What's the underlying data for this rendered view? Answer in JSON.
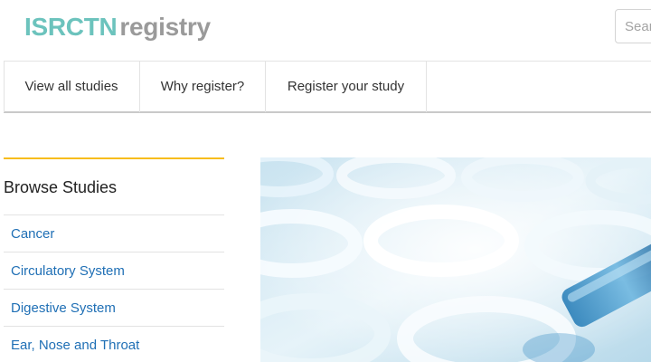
{
  "header": {
    "logo_primary": "ISRCTN",
    "logo_secondary": "registry",
    "search_placeholder": "Search"
  },
  "nav": {
    "items": [
      {
        "label": "View all studies"
      },
      {
        "label": "Why register?"
      },
      {
        "label": "Register your study"
      }
    ]
  },
  "sidebar": {
    "title": "Browse Studies",
    "items": [
      {
        "label": "Cancer"
      },
      {
        "label": "Circulatory System"
      },
      {
        "label": "Digestive System"
      },
      {
        "label": "Ear, Nose and Throat"
      }
    ]
  },
  "colors": {
    "logo_primary": "#6cc3bd",
    "logo_secondary": "#9a9a9a",
    "sidebar_accent": "#f7bd1d",
    "link": "#1f6fb5"
  }
}
